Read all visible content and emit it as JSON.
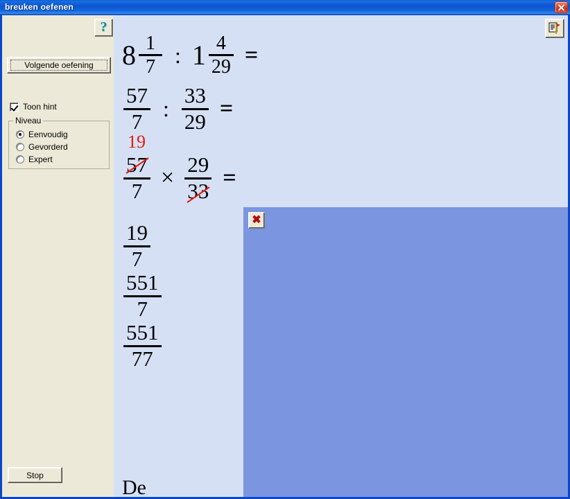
{
  "window": {
    "title": "breuken oefenen",
    "close_label": "x"
  },
  "sidebar": {
    "help_button": {
      "name": "help-button",
      "glyph": "?"
    },
    "next_exercise_button": "Volgende oefening",
    "hint_checkbox": {
      "label": "Toon hint",
      "checked": true
    },
    "level_group": {
      "title": "Niveau",
      "options": [
        {
          "label": "Eenvoudig",
          "selected": true
        },
        {
          "label": "Gevorderd",
          "selected": false
        },
        {
          "label": "Expert",
          "selected": false
        }
      ]
    },
    "stop_button": "Stop"
  },
  "main": {
    "doc_button_label": "",
    "lines": [
      {
        "id": "line1",
        "parts": [
          {
            "type": "whole",
            "value": "8"
          },
          {
            "type": "fraction",
            "num": "1",
            "den": "7"
          },
          {
            "type": "op",
            "value": ":"
          },
          {
            "type": "whole",
            "value": "1"
          },
          {
            "type": "fraction",
            "num": "4",
            "den": "29"
          },
          {
            "type": "eq",
            "value": "="
          }
        ]
      },
      {
        "id": "line2",
        "parts": [
          {
            "type": "fraction",
            "num": "57",
            "den": "7"
          },
          {
            "type": "op",
            "value": ":"
          },
          {
            "type": "fraction",
            "num": "33",
            "den": "29"
          },
          {
            "type": "eq",
            "value": "="
          }
        ]
      },
      {
        "id": "line3",
        "parts": [
          {
            "type": "fraction",
            "num": "57",
            "den": "7",
            "num_cancelled": true,
            "num_replacement": "19"
          },
          {
            "type": "op",
            "value": "×"
          },
          {
            "type": "fraction",
            "num": "29",
            "den": "33",
            "den_cancelled": true
          },
          {
            "type": "eq",
            "value": "="
          }
        ]
      },
      {
        "id": "line4",
        "parts": [
          {
            "type": "fraction",
            "num": "19",
            "den": "7"
          }
        ]
      },
      {
        "id": "line5",
        "parts": [
          {
            "type": "fraction",
            "num": "551",
            "den": "7"
          }
        ]
      },
      {
        "id": "line6",
        "parts": [
          {
            "type": "fraction",
            "num": "551",
            "den": "77"
          }
        ]
      },
      {
        "id": "line7",
        "parts": [
          {
            "type": "text",
            "value": "De"
          }
        ]
      }
    ]
  },
  "overlay": {
    "close_label": "✖",
    "body_text": ""
  },
  "colors": {
    "titlebar_blue": "#0d55cf",
    "sidebar_beige": "#ece9d8",
    "content_blue": "#d6e0f5",
    "overlay_blue": "#7b95e0",
    "cancel_red": "#e11b0c"
  }
}
